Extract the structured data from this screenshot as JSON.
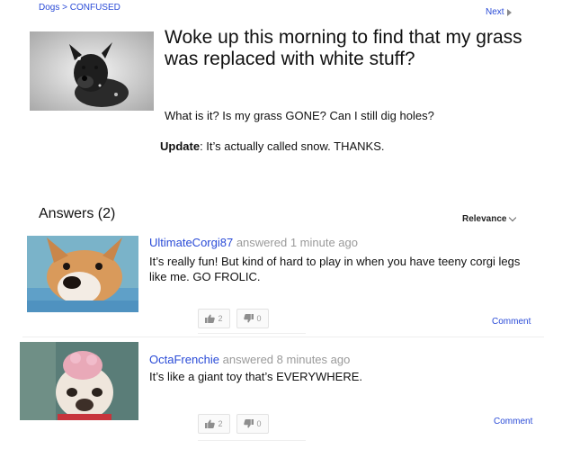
{
  "nav": {
    "breadcrumb": "Dogs > CONFUSED",
    "next_label": "Next"
  },
  "question": {
    "title": "Woke up this morning to find that my grass was replaced with white stuff?",
    "detail": "What is it? Is my grass GONE? Can I still dig holes?",
    "update_label": "Update",
    "update_text": ": It’s actually called snow. THANKS."
  },
  "answers": {
    "heading": "Answers (2)",
    "sort_label": "Relevance",
    "items": [
      {
        "user": "UltimateCorgi87",
        "answered": "answered",
        "time": "1 minute ago",
        "text": "It’s really fun! But kind of hard to play in when you have teeny corgi legs like me. GO FROLIC.",
        "thumbs_up": "2",
        "thumbs_down": "0",
        "comment_label": "Comment"
      },
      {
        "user": "OctaFrenchie",
        "answered": "answered",
        "time": "8 minutes ago",
        "text": "It’s like a giant toy that’s EVERYWHERE.",
        "thumbs_up": "2",
        "thumbs_down": "0",
        "comment_label": "Comment"
      }
    ]
  },
  "colors": {
    "link": "#2a4bd7",
    "muted": "#9a9a9a"
  },
  "icons": [
    "chevron-right-icon",
    "chevron-down-icon",
    "thumbs-up-icon",
    "thumbs-down-icon"
  ]
}
